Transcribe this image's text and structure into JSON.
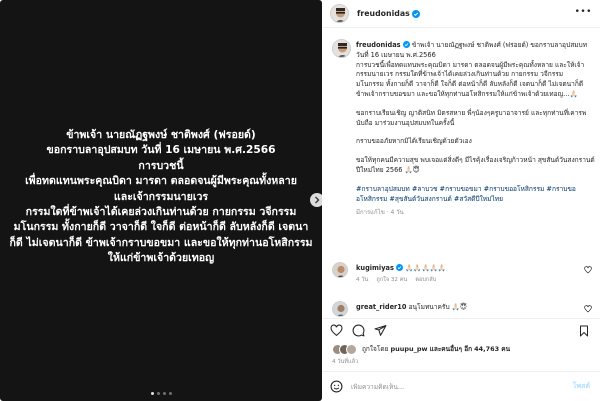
{
  "media": {
    "lines": [
      "ข้าพเจ้า นายณัฏฐพงษ์ ชาติพงศ์ (ฟรอยด์)",
      "ขอกราบลาอุปสมบท วันที่ 16 เมษายน พ.ศ.2566",
      "การบวชนี้",
      "เพื่อทดแทนพระคุณบิดา มารดา ตลอดจนผู้มีพระคุณทั้งหลาย",
      "และเจ้ากรรมนายเวร",
      "กรรมใดที่ข้าพเจ้าได้เคยล่วงเกินท่านด้วย กายกรรม วจีกรรม",
      "มโนกรรม ทั้งกายก็ดี วาจาก็ดี ใจก็ดี ต่อหน้าก็ดี ลับหลังก็ดี เจตนา",
      "ก็ดี ไม่เจตนาก็ดี ข้าพเจ้ากราบขอขมา และขอให้ทุกท่านอโหสิกรรม",
      "ให้แก่ข้าพเจ้าด้วยเทอญ"
    ],
    "slide_count": 4,
    "active_slide": 1
  },
  "header": {
    "username": "freudonidas",
    "more_icon": "ellipsis-icon"
  },
  "caption": {
    "username": "freudonidas",
    "paragraphs": [
      "ข้าพเจ้า นายณัฏฐพงษ์ ชาติพงศ์ (ฟรอยด์) ขอกราบลาอุปสมบท วันที่ 16 เมษายน พ.ศ.2566",
      "การบวชนี้เพื่อทดแทนพระคุณบิดา มารดา ตลอดจนผู้มีพระคุณทั้งหลาย และให้เจ้ากรรมนายเวร กรรมใดที่ข้าพเจ้าได้เคยล่วงเกินท่านด้วย กายกรรม วจีกรรม",
      "มโนกรรม ทั้งกายก็ดี วาจาก็ดี ใจก็ดี ต่อหน้าก็ดี ลับหลังก็ดี เจตนาก็ดี ไม่เจตนาก็ดี ข้าพเจ้ากราบขอขมา และขอให้ทุกท่านอโหสิกรรมให้แก่ข้าพเจ้าด้วยเทอญ...🙏🏻",
      "ขอกราบเรียนเชิญ ญาติสนิท มิตรสหาย พี่ๆน้องๆครูบาอาจารย์ และทุกท่านที่เคารพนับถือ มาร่วมงานอุปสมบทในครั้งนี้",
      "กราบขออภัยหากมิได้เรียนเชิญด้วยตัวเอง",
      "ขอให้ทุกคนมีความสุข พบเจอแต่สิ่งดีๆ มีไรคุ้งเรื่องเจริญก้าวหน้า สุขสันต์วันสงกรานต์ ปีใหม่ไทย 2566 🙏🏻😇"
    ],
    "hashtags": "#กราบลาอุปสมบท #ลาบวช #กราบขอขมา #กราบขออโหสิกรรม #กราบขออโหสิกรรม #สุขสันต์วันสงกรานต์ #สวัสดีปีใหม่ไทย",
    "meta": "มีการแก้ไข · 4 วัน"
  },
  "comments": [
    {
      "username": "kugimiyas",
      "text": "🙏🏻🙏🏻🙏🏻🙏🏻🙏🏻",
      "age": "4 วัน",
      "likes": "ถูกใจ 32 คน",
      "reply": "ตอบกลับ"
    },
    {
      "username": "great_rider10",
      "text": "อนุโมทนาครับ 🙏🏻😇"
    }
  ],
  "likes": {
    "prefix": "ถูกใจโดย",
    "first_user": "puupu_pw",
    "middle": "และคนอื่นๆ อีก",
    "count": "44,763",
    "suffix": "คน"
  },
  "post_date": "4 วันที่แล้ว",
  "add_comment": {
    "placeholder": "เพิ่มความคิดเห็น...",
    "post_label": "โพสต์"
  }
}
